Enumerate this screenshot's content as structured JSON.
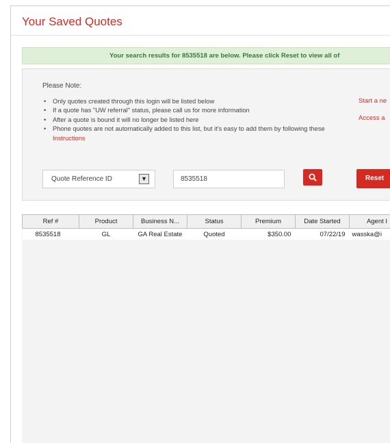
{
  "page": {
    "title": "Your Saved Quotes"
  },
  "alert": {
    "message": "Your search results for 8535518 are below. Please click Reset to view all of"
  },
  "notes": {
    "heading": "Please Note:",
    "items": [
      {
        "text": "Only quotes created through this login will be listed below"
      },
      {
        "text": "If a quote has \"UW referral\" status, please call us for more information"
      },
      {
        "text": "After a quote is bound it will no longer be listed here"
      },
      {
        "text": "Phone quotes are not automatically added to this list, but it's easy to add them by following these ",
        "link": "Instructions"
      }
    ]
  },
  "side_links": {
    "start_new": "Start a ne",
    "access": "Access a"
  },
  "search": {
    "field_select": "Quote Reference ID",
    "query": "8535518",
    "search_icon": "search-icon",
    "reset_label": "Reset"
  },
  "table": {
    "columns": [
      "Ref #",
      "Product",
      "Business N...",
      "Status",
      "Premium",
      "Date Started",
      "Agent I"
    ],
    "rows": [
      [
        "8535518",
        "GL",
        "GA Real Estate",
        "Quoted",
        "$350.00",
        "07/22/19",
        "wasska@i"
      ]
    ]
  },
  "colors": {
    "accent": "#d42a22",
    "alert_bg": "#dff0d8",
    "alert_text": "#3c763d"
  }
}
